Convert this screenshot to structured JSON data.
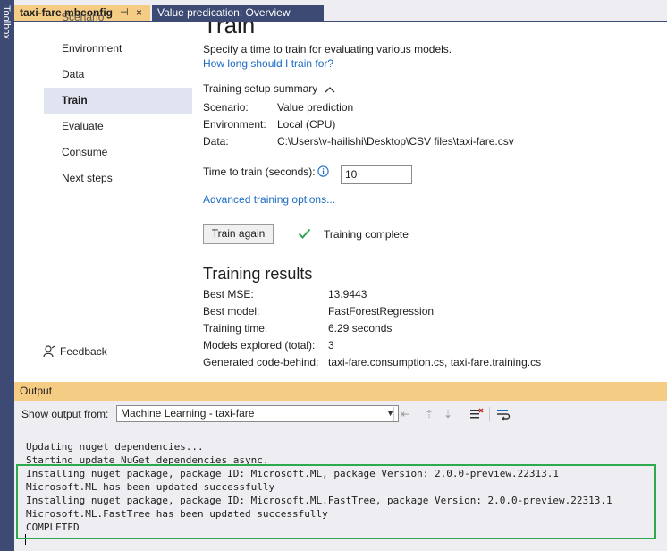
{
  "toolbox": {
    "label": "Toolbox"
  },
  "tabs": [
    {
      "label": "taxi-fare.mbconfig",
      "pin": "⊣",
      "close": "×"
    },
    {
      "label": "Value predication: Overview"
    }
  ],
  "nav": {
    "items": [
      {
        "label": "Scenario"
      },
      {
        "label": "Environment"
      },
      {
        "label": "Data"
      },
      {
        "label": "Train"
      },
      {
        "label": "Evaluate"
      },
      {
        "label": "Consume"
      },
      {
        "label": "Next steps"
      }
    ],
    "feedback": "Feedback"
  },
  "main": {
    "title": "Train",
    "intro": "Specify a time to train for evaluating various models.",
    "how_long_link": "How long should I train for?",
    "summary": {
      "title": "Training setup summary",
      "rows": [
        {
          "label": "Scenario:",
          "value": "Value prediction"
        },
        {
          "label": "Environment:",
          "value": "Local (CPU)"
        },
        {
          "label": "Data:",
          "value": "C:\\Users\\v-hailishi\\Desktop\\CSV files\\taxi-fare.csv"
        }
      ]
    },
    "time_to_train": {
      "label": "Time to train (seconds):",
      "value": "10"
    },
    "advanced_link": "Advanced training options...",
    "train_again_label": "Train again",
    "status": "Training complete",
    "results": {
      "title": "Training results",
      "rows": [
        {
          "label": "Best MSE:",
          "value": "13.9443"
        },
        {
          "label": "Best model:",
          "value": "FastForestRegression"
        },
        {
          "label": "Training time:",
          "value": "6.29 seconds"
        },
        {
          "label": "Models explored (total):",
          "value": "3"
        },
        {
          "label": "Generated code-behind:",
          "value": "taxi-fare.consumption.cs, taxi-fare.training.cs"
        }
      ]
    }
  },
  "output": {
    "title": "Output",
    "show_from_label": "Show output from:",
    "source": "Machine Learning - taxi-fare",
    "lines": [
      "Updating nuget dependencies...",
      "Starting update NuGet dependencies async.",
      "Installing nuget package, package ID: Microsoft.ML, package Version: 2.0.0-preview.22313.1",
      "Microsoft.ML has been updated successfully",
      "Installing nuget package, package ID: Microsoft.ML.FastTree, package Version: 2.0.0-preview.22313.1",
      "Microsoft.ML.FastTree has been updated successfully",
      "COMPLETED"
    ]
  },
  "colors": {
    "accent_tab": "#f5cc84",
    "dark_tab": "#3d4b74",
    "link": "#1a6bc4",
    "success": "#2fa84f"
  }
}
